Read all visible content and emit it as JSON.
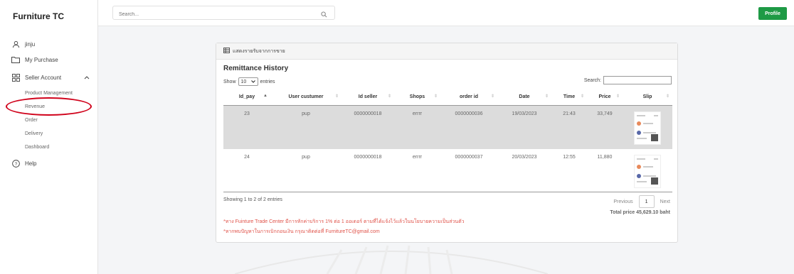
{
  "sidebar": {
    "brand": "Furniture TC",
    "user": "jinju",
    "my_purchase": "My Purchase",
    "seller_account": "Seller Account",
    "sub_items": [
      "Product Management",
      "Revenue",
      "Order",
      "Delivery",
      "Dashboard"
    ],
    "help": "Help"
  },
  "topbar": {
    "search_placeholder": "Search...",
    "profile_label": "Profile"
  },
  "panel": {
    "header": "แสดงรายรับจากการขาย",
    "title": "Remittance History",
    "show_label": "Show",
    "entries_value": "10",
    "entries_label": "entries",
    "search_label": "Search:",
    "columns": [
      "Id_pay",
      "User custumer",
      "Id seller",
      "Shops",
      "order id",
      "Date",
      "Time",
      "Price",
      "Slip"
    ],
    "rows": [
      {
        "id_pay": "23",
        "user": "pup",
        "id_seller": "0000000018",
        "shop": "errrr",
        "order_id": "0000000036",
        "date": "19/03/2023",
        "time": "21:43",
        "price": "33,749"
      },
      {
        "id_pay": "24",
        "user": "pup",
        "id_seller": "0000000018",
        "shop": "errrr",
        "order_id": "0000000037",
        "date": "20/03/2023",
        "time": "12:55",
        "price": "11,880"
      }
    ],
    "showing_info": "Showing 1 to 2 of 2 entries",
    "previous": "Previous",
    "page": "1",
    "next": "Next",
    "total": "Total price 45,629.10 baht",
    "note1": "*ทาง Fuinture Trade Center มีการหักค่าบริการ 1% ต่อ 1 ออเดอร์ ตามที่ได้แจ้งไว้แล้วในนโยบายความเป็นส่วนตัว",
    "note2": "*หากพบปัญหาในการเบิกถอนเงิน กรุณาติดต่อที่ FurnitureTC@gmail.com"
  },
  "colors": {
    "accent": "#1e9a45",
    "highlight_circle": "#d0021b",
    "note": "#e0534a"
  }
}
